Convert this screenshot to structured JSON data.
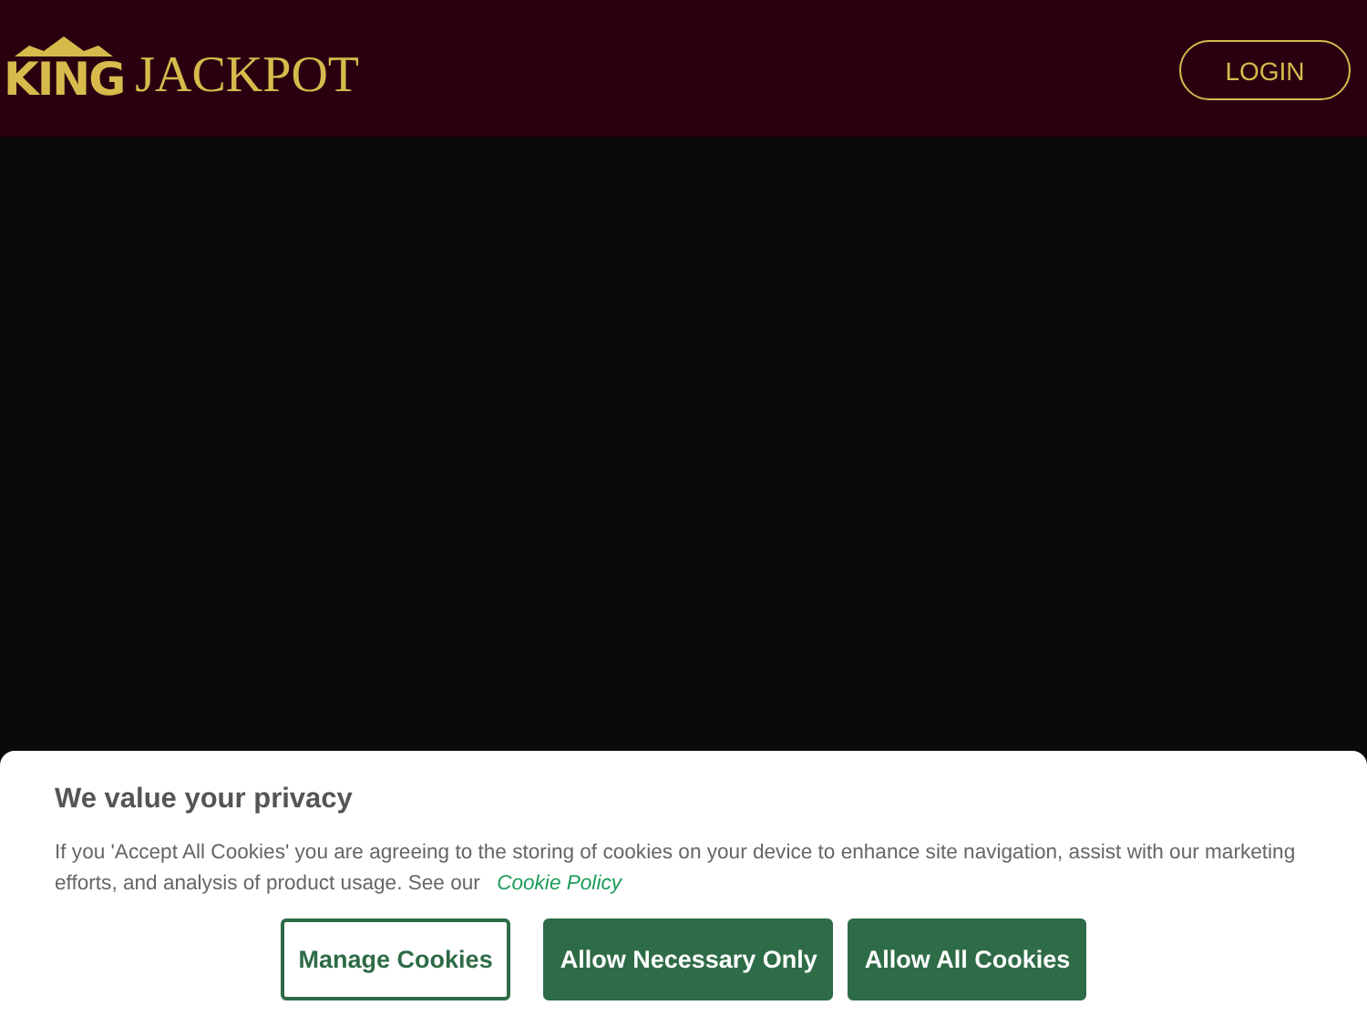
{
  "header": {
    "logo": {
      "first": "KING",
      "second": "JACKPOT"
    },
    "login_button": "LOGIN"
  },
  "cookie_banner": {
    "title": "We value your privacy",
    "text": "If you 'Accept All Cookies' you are agreeing to the storing of cookies on your device to enhance site navigation, assist with our marketing efforts, and analysis of product usage. See our",
    "link": "Cookie Policy",
    "buttons": [
      {
        "label": "Manage Cookies",
        "kind": "outline"
      },
      {
        "label": "Allow Necessary Only",
        "kind": "filled"
      },
      {
        "label": "Allow All Cookies",
        "kind": "filled"
      }
    ]
  }
}
